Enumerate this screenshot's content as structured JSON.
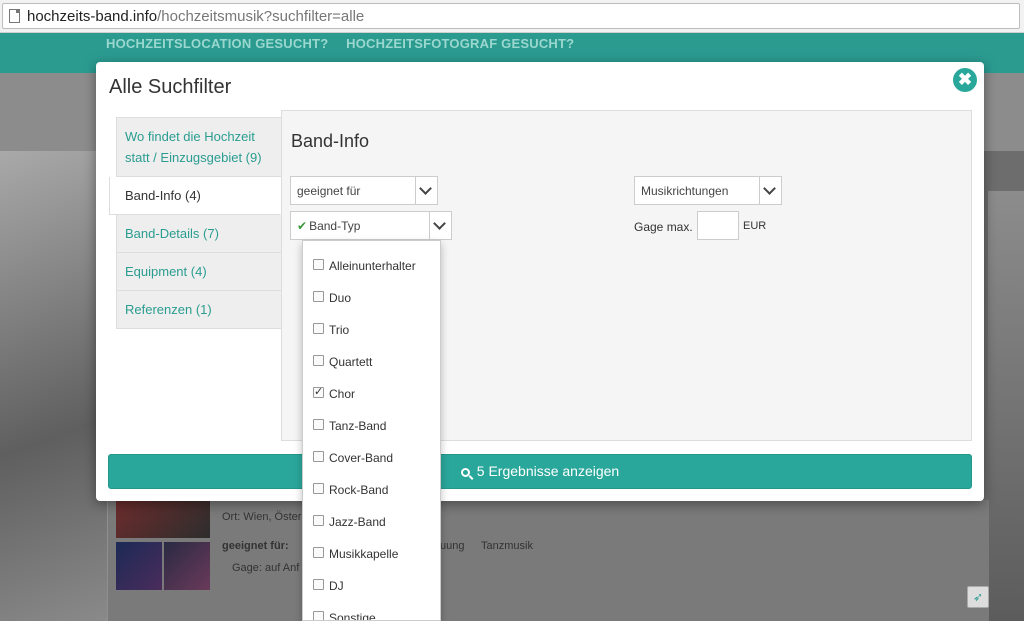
{
  "browser": {
    "url_host": "hochzeits-band.info",
    "url_path": "/hochzeitsmusik?suchfilter=alle"
  },
  "site": {
    "nav": [
      "HOCHZEITSLOCATION GESUCHT?",
      "HOCHZEITSFOTOGRAF GESUCHT?"
    ],
    "card_ort": "Ort: Wien, Öster",
    "card_geeignet": "geeignet für:",
    "card_tanz": "uung",
    "card_tanzmusik": "Tanzmusik",
    "card_gage": "Gage: auf Anf"
  },
  "modal": {
    "title": "Alle Suchfilter",
    "close": "✖",
    "tabs": [
      {
        "label": "Wo findet die Hochzeit statt / Einzugsgebiet (9)"
      },
      {
        "label": "Band-Info (4)"
      },
      {
        "label": "Band-Details (7)"
      },
      {
        "label": "Equipment (4)"
      },
      {
        "label": "Referenzen (1)"
      }
    ],
    "panel_title": "Band-Info",
    "select_geeignet": "geeignet für",
    "select_bandtyp": "Band-Typ",
    "select_musik": "Musikrichtungen",
    "gage_label": "Gage max.",
    "gage_value": "",
    "gage_unit": "EUR",
    "submit_label": "5 Ergebnisse anzeigen"
  },
  "band_types": [
    {
      "label": "Alleinunterhalter",
      "checked": false
    },
    {
      "label": "Duo",
      "checked": false
    },
    {
      "label": "Trio",
      "checked": false
    },
    {
      "label": "Quartett",
      "checked": false
    },
    {
      "label": "Chor",
      "checked": true
    },
    {
      "label": "Tanz-Band",
      "checked": false
    },
    {
      "label": "Cover-Band",
      "checked": false
    },
    {
      "label": "Rock-Band",
      "checked": false
    },
    {
      "label": "Jazz-Band",
      "checked": false
    },
    {
      "label": "Musikkapelle",
      "checked": false
    },
    {
      "label": "DJ",
      "checked": false
    },
    {
      "label": "Sonstige",
      "checked": false
    }
  ],
  "colors": {
    "accent": "#2aa79b",
    "link": "#2a9d90"
  }
}
